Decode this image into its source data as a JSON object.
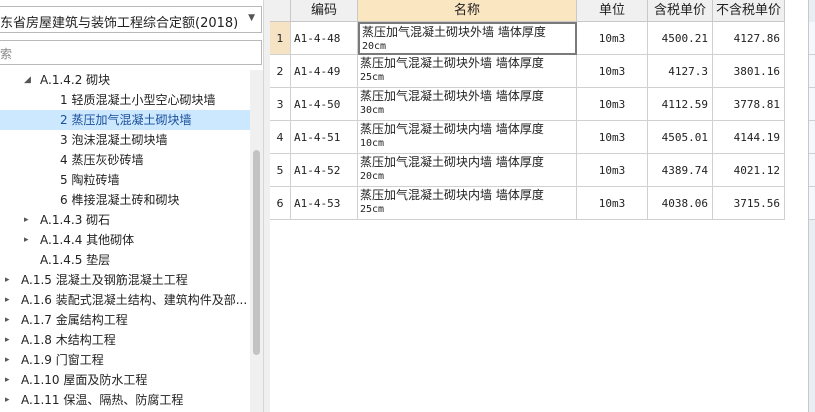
{
  "library": {
    "selected": "东省房屋建筑与装饰工程综合定额(2018)"
  },
  "search": {
    "placeholder": "索"
  },
  "tree": [
    {
      "label": "A.1.4.2 砌块",
      "level": 2,
      "arrow": "down"
    },
    {
      "label": "1 轻质混凝土小型空心砌块墙",
      "level": 3
    },
    {
      "label": "2 蒸压加气混凝土砌块墙",
      "level": 3,
      "selected": true
    },
    {
      "label": "3 泡沫混凝土砌块墙",
      "level": 3
    },
    {
      "label": "4 蒸压灰砂砖墙",
      "level": 3
    },
    {
      "label": "5 陶粒砖墙",
      "level": 3
    },
    {
      "label": "6 榫接混凝土砖和砌块",
      "level": 3
    },
    {
      "label": "A.1.4.3 砌石",
      "level": 2,
      "arrow": "right"
    },
    {
      "label": "A.1.4.4 其他砌体",
      "level": 2,
      "arrow": "right"
    },
    {
      "label": "A.1.4.5 垫层",
      "level": 2
    },
    {
      "label": "A.1.5 混凝土及钢筋混凝土工程",
      "level": 1,
      "arrow": "right"
    },
    {
      "label": "A.1.6 装配式混凝土结构、建筑构件及部...",
      "level": 1,
      "arrow": "right"
    },
    {
      "label": "A.1.7 金属结构工程",
      "level": 1,
      "arrow": "right"
    },
    {
      "label": "A.1.8 木结构工程",
      "level": 1,
      "arrow": "right"
    },
    {
      "label": "A.1.9 门窗工程",
      "level": 1,
      "arrow": "right"
    },
    {
      "label": "A.1.10 屋面及防水工程",
      "level": 1,
      "arrow": "right"
    },
    {
      "label": "A.1.11 保温、隔热、防腐工程",
      "level": 1,
      "arrow": "right"
    }
  ],
  "table": {
    "headers": {
      "code": "编码",
      "name": "名称",
      "unit": "单位",
      "price_tax": "含税单价",
      "price_notax": "不含税单价"
    },
    "rows": [
      {
        "num": "1",
        "code": "A1-4-48",
        "name1": "蒸压加气混凝土砌块外墙 墙体厚度",
        "name2": "20cm",
        "unit": "10m3",
        "price_tax": "4500.21",
        "price_notax": "4127.86"
      },
      {
        "num": "2",
        "code": "A1-4-49",
        "name1": "蒸压加气混凝土砌块外墙 墙体厚度",
        "name2": "25cm",
        "unit": "10m3",
        "price_tax": "4127.3",
        "price_notax": "3801.16"
      },
      {
        "num": "3",
        "code": "A1-4-50",
        "name1": "蒸压加气混凝土砌块外墙 墙体厚度",
        "name2": "30cm",
        "unit": "10m3",
        "price_tax": "4112.59",
        "price_notax": "3778.81"
      },
      {
        "num": "4",
        "code": "A1-4-51",
        "name1": "蒸压加气混凝土砌块内墙 墙体厚度",
        "name2": "10cm",
        "unit": "10m3",
        "price_tax": "4505.01",
        "price_notax": "4144.19"
      },
      {
        "num": "5",
        "code": "A1-4-52",
        "name1": "蒸压加气混凝土砌块内墙 墙体厚度",
        "name2": "20cm",
        "unit": "10m3",
        "price_tax": "4389.74",
        "price_notax": "4021.12"
      },
      {
        "num": "6",
        "code": "A1-4-53",
        "name1": "蒸压加气混凝土砌块内墙 墙体厚度",
        "name2": "25cm",
        "unit": "10m3",
        "price_tax": "4038.06",
        "price_notax": "3715.56"
      }
    ]
  },
  "icons": {
    "dropdown": "chevron-down-icon",
    "expand": "caret-right-icon",
    "collapse": "caret-down-icon"
  },
  "colors": {
    "selection": "#cce8ff",
    "header_active": "#fbe6c2"
  }
}
